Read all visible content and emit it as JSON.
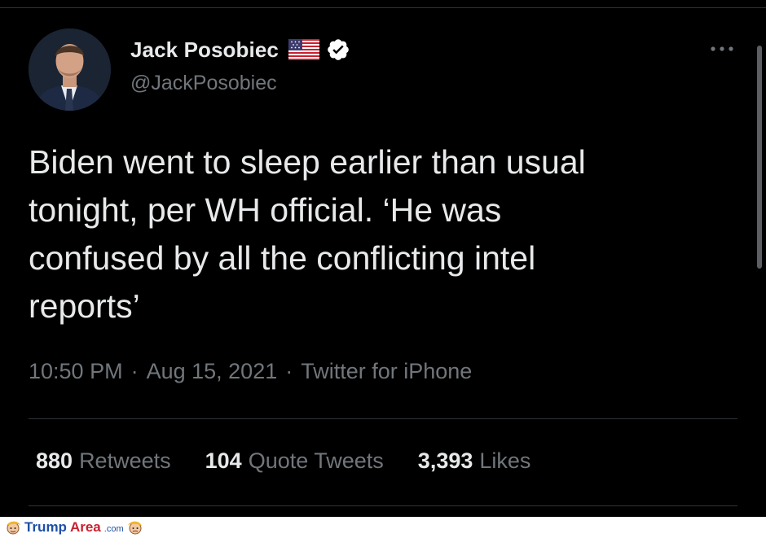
{
  "colors": {
    "background": "#000000",
    "primary_text": "#e7e9ea",
    "secondary_text": "#71767b",
    "divider": "#2f3336",
    "verified": "#ffffff"
  },
  "author": {
    "display_name": "Jack Posobiec",
    "handle": "@JackPosobiec",
    "flag_icon": "us-flag-icon",
    "verified_icon": "verified-badge-icon"
  },
  "tweet": {
    "text": "Biden went to sleep earlier than usual\ntonight, per WH official. ‘He was\nconfused by all the conflicting intel\nreports’"
  },
  "meta": {
    "time": "10:50 PM",
    "separator": "·",
    "date": "Aug 15, 2021",
    "source": "Twitter for iPhone"
  },
  "stats": [
    {
      "count": "880",
      "label": "Retweets"
    },
    {
      "count": "104",
      "label": "Quote Tweets"
    },
    {
      "count": "3,393",
      "label": "Likes"
    }
  ],
  "watermark": {
    "part1": "Trump",
    "part2": "Area",
    "part3": ".com"
  }
}
